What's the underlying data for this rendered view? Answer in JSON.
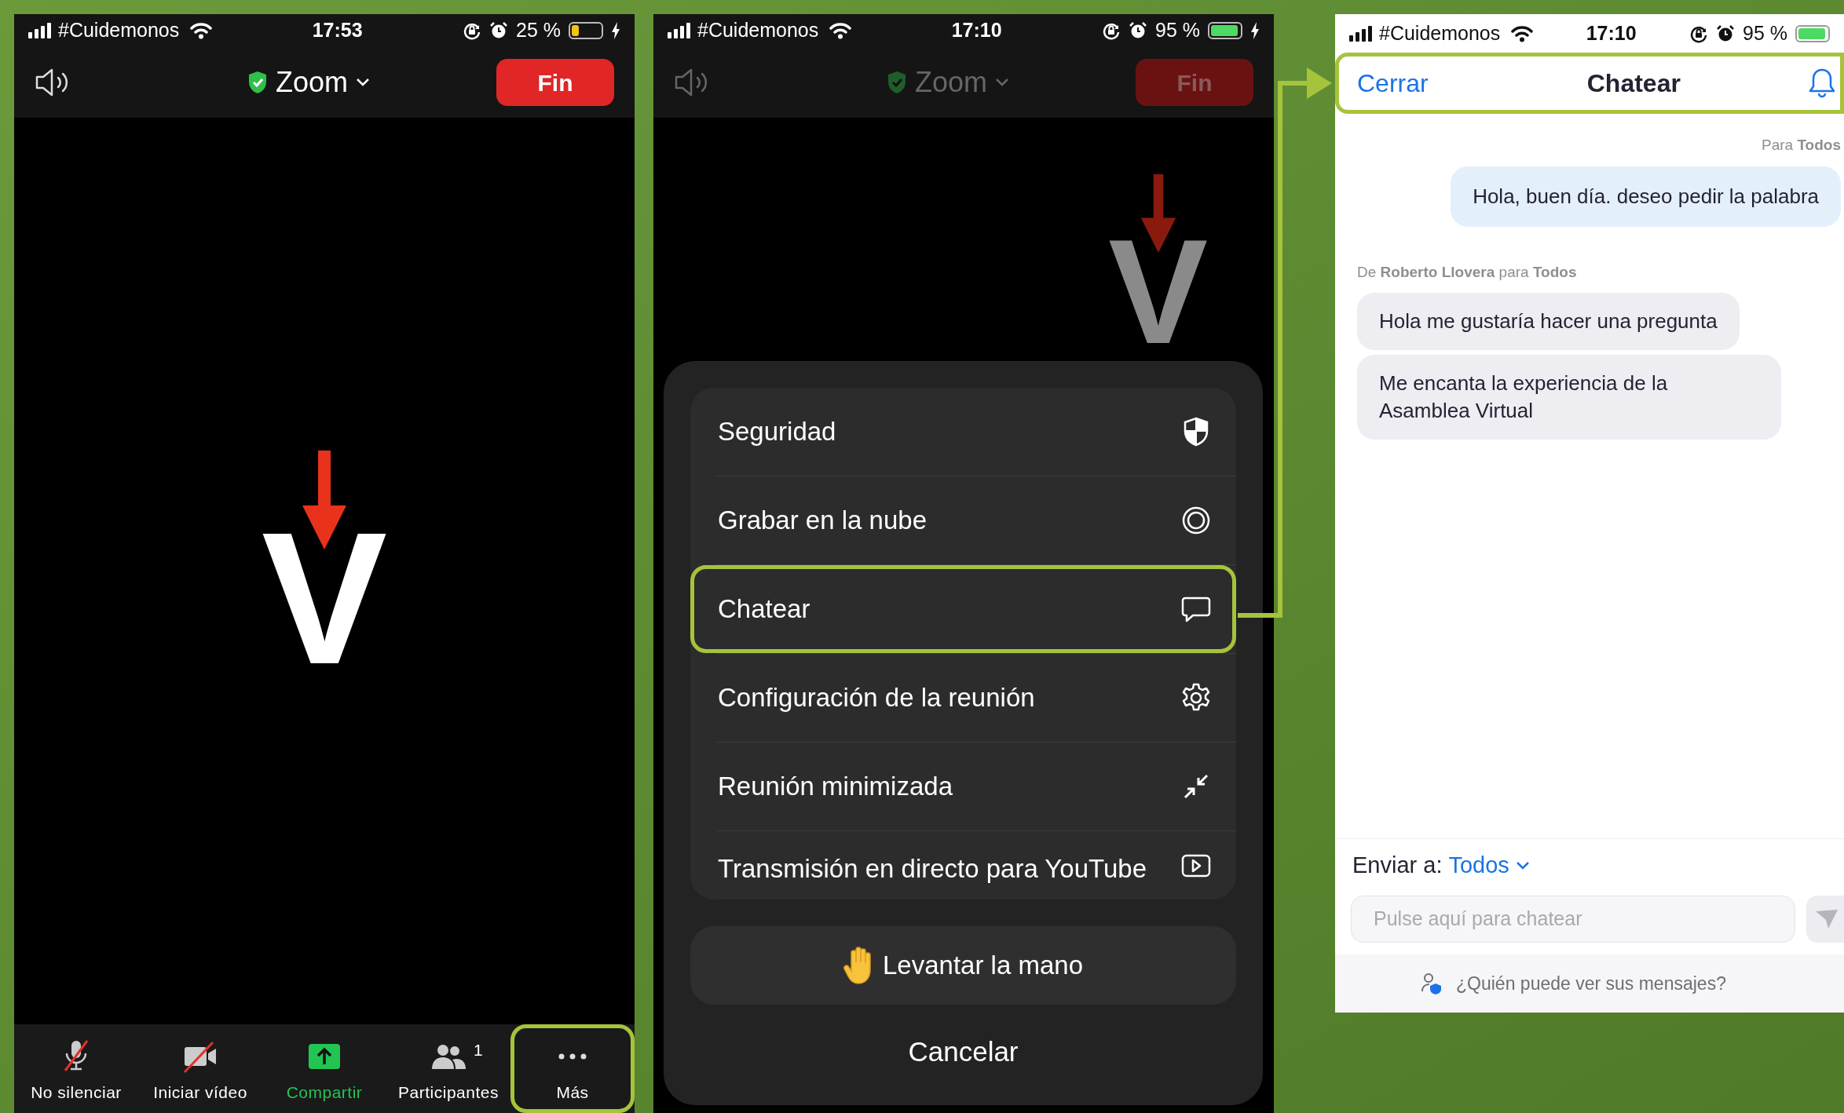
{
  "screens": [
    {
      "kind": "meeting",
      "status_bar": {
        "carrier": "#Cuidemonos",
        "time": "17:53",
        "battery": "25 %",
        "charging": true
      },
      "header": {
        "title": "Zoom",
        "end_button": "Fin",
        "dimmed": false
      },
      "logo": {
        "letter": "V",
        "dimmed": false
      },
      "toolbar": [
        {
          "kind": "mic_off",
          "label": "No silenciar",
          "callout": false
        },
        {
          "kind": "video_off",
          "label": "Iniciar vídeo",
          "callout": false
        },
        {
          "kind": "share",
          "label": "Compartir",
          "callout": false
        },
        {
          "kind": "participants",
          "label": "Participantes",
          "badge": "1",
          "callout": false
        },
        {
          "kind": "more",
          "label": "Más",
          "callout": true
        }
      ]
    },
    {
      "kind": "meeting_menu",
      "status_bar": {
        "carrier": "#Cuidemonos",
        "time": "17:10",
        "battery": "95 %",
        "charging": true
      },
      "header": {
        "title": "Zoom",
        "end_button": "Fin",
        "dimmed": true
      },
      "logo": {
        "letter": "V",
        "dimmed": true
      },
      "menu": [
        {
          "kind": "shield",
          "label": "Seguridad",
          "callout": false
        },
        {
          "kind": "record",
          "label": "Grabar en la nube",
          "callout": false
        },
        {
          "kind": "chat",
          "label": "Chatear",
          "callout": true
        },
        {
          "kind": "gear",
          "label": "Configuración de la reunión",
          "callout": false
        },
        {
          "kind": "minimize",
          "label": "Reunión minimizada",
          "callout": false
        },
        {
          "kind": "stream",
          "label": "Transmisión en directo para YouTube",
          "callout": false
        }
      ],
      "raise_hand": "Levantar la mano",
      "cancel": "Cancelar"
    },
    {
      "kind": "chat",
      "status_bar": {
        "carrier": "#Cuidemonos",
        "time": "17:10",
        "battery": "95 %",
        "charging": false
      },
      "header": {
        "close": "Cerrar",
        "title": "Chatear",
        "callout": true
      },
      "groups": [
        {
          "kind": "sent",
          "meta": "Para **Todos**",
          "bubbles": [
            "Hola, buen día. deseo pedir la palabra"
          ]
        },
        {
          "kind": "received",
          "meta": "De **Roberto Llovera** para **Todos**",
          "bubbles": [
            "Hola me gustaría hacer una pregunta",
            "Me encanta la experiencia de la Asamblea Virtual"
          ]
        }
      ],
      "composer": {
        "send_to_label": "Enviar a:",
        "send_to_value": "Todos",
        "placeholder": "Pulse aquí para chatear"
      },
      "privacy_note": "¿Quién puede ver sus mensajes?"
    }
  ]
}
